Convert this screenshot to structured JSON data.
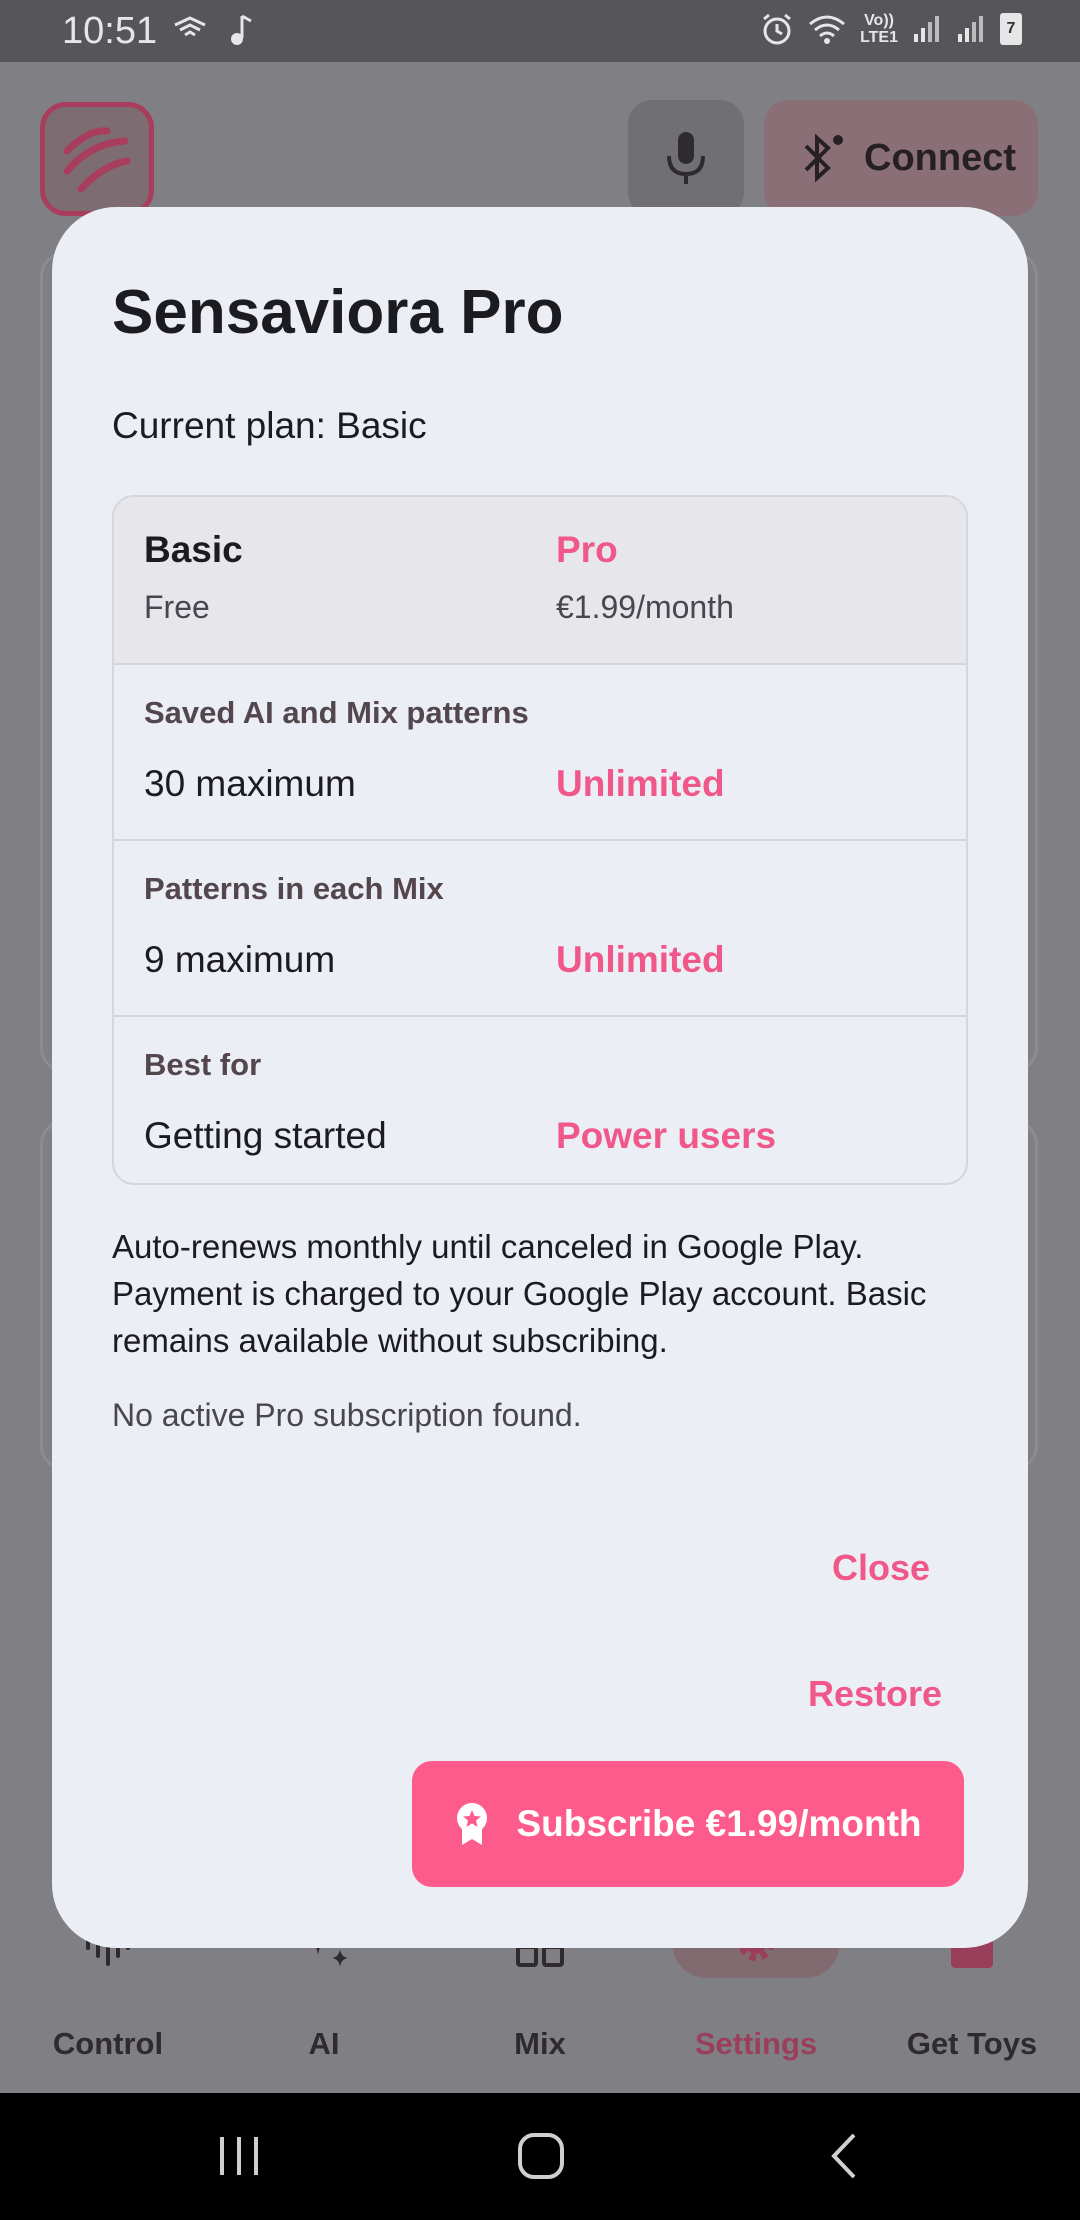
{
  "status_bar": {
    "time": "10:51",
    "network_line1": "Vo))",
    "network_line2": "LTE1",
    "battery_level": "7"
  },
  "header": {
    "connect_label": "Connect"
  },
  "dialog": {
    "title": "Sensaviora Pro",
    "current_plan": "Current plan: Basic",
    "plans": {
      "basic_name": "Basic",
      "basic_price": "Free",
      "pro_name": "Pro",
      "pro_price": "€1.99/month"
    },
    "rows": [
      {
        "label": "Saved AI and Mix patterns",
        "basic": "30 maximum",
        "pro": "Unlimited"
      },
      {
        "label": "Patterns in each Mix",
        "basic": "9 maximum",
        "pro": "Unlimited"
      },
      {
        "label": "Best for",
        "basic": "Getting started",
        "pro": "Power users"
      }
    ],
    "renew_note": "Auto-renews monthly until canceled in Google Play. Payment is charged to your Google Play account. Basic remains available without subscribing.",
    "status_message": "No active Pro subscription found.",
    "close_label": "Close",
    "restore_label": "Restore",
    "subscribe_label": "Subscribe €1.99/month"
  },
  "bottom_nav": {
    "items": [
      {
        "label": "Control",
        "icon": "waveform-icon"
      },
      {
        "label": "AI",
        "icon": "sparkle-icon"
      },
      {
        "label": "Mix",
        "icon": "grid-icon"
      },
      {
        "label": "Settings",
        "icon": "gear-icon",
        "active": true
      },
      {
        "label": "Get Toys",
        "icon": "shopping-bag-icon"
      }
    ]
  },
  "colors": {
    "accent": "#f0588a",
    "subscribe_bg": "#fd5b8b",
    "dialog_bg": "#eceef5",
    "text": "#1c1b20"
  }
}
